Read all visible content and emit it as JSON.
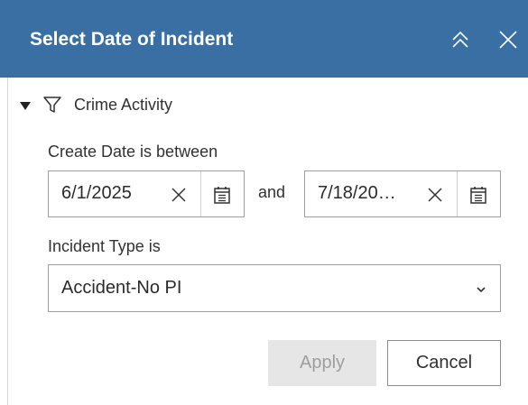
{
  "panel": {
    "title": "Select Date of Incident",
    "header_color": "#3a6fa3",
    "collapse_icon": "double-chevron-up-icon",
    "close_icon": "close-icon"
  },
  "section": {
    "label": "Crime Activity",
    "expanded": true,
    "icon": "filter-icon"
  },
  "create_date": {
    "label": "Create Date is between",
    "start_value": "6/1/2025",
    "connector": "and",
    "end_value": "7/18/20…",
    "clear_icon": "close-icon",
    "calendar_icon": "calendar-icon"
  },
  "incident_type": {
    "label": "Incident Type is",
    "selected": "Accident-No PI",
    "dropdown_icon": "chevron-down-icon"
  },
  "actions": {
    "apply_label": "Apply",
    "apply_enabled": false,
    "cancel_label": "Cancel"
  }
}
